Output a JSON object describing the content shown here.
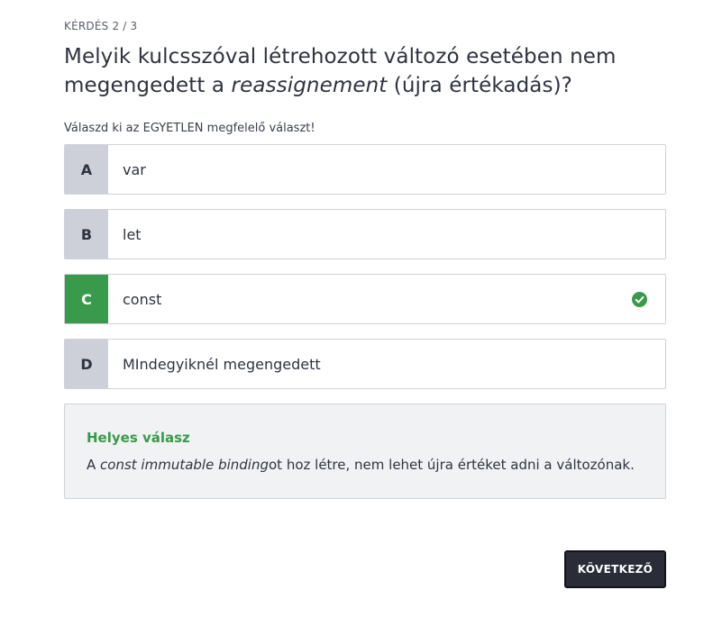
{
  "progress": "KÉRDÉS 2 / 3",
  "question": {
    "before": "Melyik kulcsszóval létrehozott változó esetében nem megengedett a ",
    "emphasis": "reassignement",
    "after": " (újra értékadás)?"
  },
  "instruction": "Válaszd ki az EGYETLEN megfelelő választ!",
  "options": [
    {
      "letter": "A",
      "text": "var",
      "state": "default"
    },
    {
      "letter": "B",
      "text": "let",
      "state": "default"
    },
    {
      "letter": "C",
      "text": "const",
      "state": "correct"
    },
    {
      "letter": "D",
      "text": "MIndegyiknél megengedett",
      "state": "default"
    }
  ],
  "feedback": {
    "title": "Helyes válasz",
    "body_prefix": "A ",
    "body_emphasis": "const immutable binding",
    "body_suffix": "ot hoz létre, nem lehet újra értéket adni a változónak."
  },
  "next_button": "KÖVETKEZŐ",
  "icons": {
    "check": "check-circle-icon"
  },
  "colors": {
    "correct": "#3a9a4b",
    "letter_bg": "#cdd0d8",
    "button_bg": "#2a2d38",
    "feedback_bg": "#f1f2f4",
    "text": "#2e3340"
  }
}
